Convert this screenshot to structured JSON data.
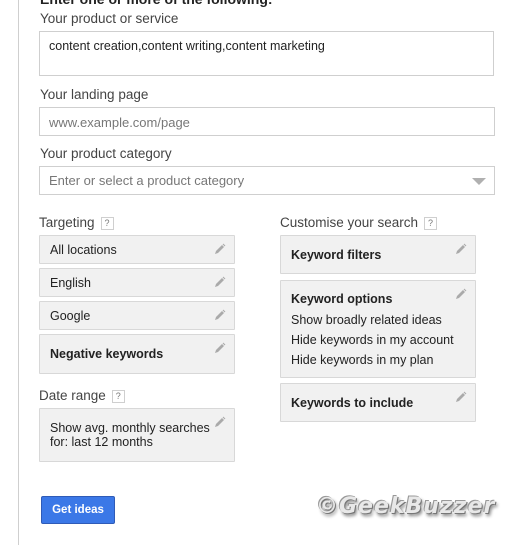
{
  "form": {
    "heading": "Enter one or more of the following:",
    "product": {
      "label": "Your product or service",
      "value": "content creation,content writing,content marketing"
    },
    "landing": {
      "label": "Your landing page",
      "placeholder": "www.example.com/page"
    },
    "category": {
      "label": "Your product category",
      "placeholder": "Enter or select a product category"
    }
  },
  "targeting": {
    "label": "Targeting",
    "help": "?",
    "items": [
      {
        "label": "All locations"
      },
      {
        "label": "English"
      },
      {
        "label": "Google"
      },
      {
        "label": "Negative keywords"
      }
    ]
  },
  "date_range": {
    "label": "Date range",
    "help": "?",
    "line1": "Show avg. monthly searches",
    "line2": "for: last 12 months"
  },
  "customise": {
    "label": "Customise your search",
    "help": "?",
    "filters": "Keyword filters",
    "options": {
      "title": "Keyword options",
      "lines": [
        "Show broadly related ideas",
        "Hide keywords in my account",
        "Hide keywords in my plan"
      ]
    },
    "include": "Keywords to include"
  },
  "actions": {
    "get_ideas": "Get ideas"
  },
  "watermark": "©GeekBuzzer"
}
